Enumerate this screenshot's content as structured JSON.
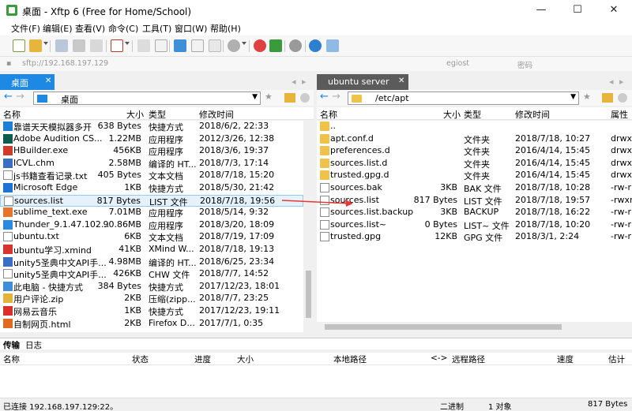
{
  "window": {
    "title": "桌面 - Xftp 6 (Free for Home/School)",
    "minimize": "—",
    "maximize": "☐",
    "close": "✕"
  },
  "menu": [
    "文件(F)",
    "编辑(E)",
    "查看(V)",
    "命令(C)",
    "工具(T)",
    "窗口(W)",
    "帮助(H)"
  ],
  "address": {
    "url": "sftp://192.168.197.129",
    "user_placeholder": "egiost",
    "password_placeholder": "密码"
  },
  "left_pane": {
    "tab": "桌面",
    "path": "桌面",
    "columns": [
      "名称",
      "大小",
      "类型",
      "修改时间"
    ],
    "files": [
      {
        "name": "靠谱天天模拟器多开",
        "size": "638 Bytes",
        "type": "快捷方式",
        "modified": "2018/6/2, 22:33",
        "icon": "#1e7fd6"
      },
      {
        "name": "Adobe Audition CS...",
        "size": "1.22MB",
        "type": "应用程序",
        "modified": "2012/3/26, 12:38",
        "icon": "#0b5e4e"
      },
      {
        "name": "HBuilder.exe",
        "size": "456KB",
        "type": "应用程序",
        "modified": "2018/3/6, 19:37",
        "icon": "#d03a2a"
      },
      {
        "name": "ICVL.chm",
        "size": "2.58MB",
        "type": "编译的 HT...",
        "modified": "2018/7/3, 17:14",
        "icon": "#3b6fc4"
      },
      {
        "name": "js书籍查看记录.txt",
        "size": "405 Bytes",
        "type": "文本文档",
        "modified": "2018/7/18, 15:20",
        "icon": "#ffffff"
      },
      {
        "name": "Microsoft Edge",
        "size": "1KB",
        "type": "快捷方式",
        "modified": "2018/5/30, 21:42",
        "icon": "#1c73d4"
      },
      {
        "name": "sources.list",
        "size": "817 Bytes",
        "type": "LIST 文件",
        "modified": "2018/7/18, 19:56",
        "icon": "#ffffff",
        "selected": true
      },
      {
        "name": "sublime_text.exe",
        "size": "7.01MB",
        "type": "应用程序",
        "modified": "2018/5/14, 9:32",
        "icon": "#e8742b"
      },
      {
        "name": "Thunder_9.1.47.102...",
        "size": "90.86MB",
        "type": "应用程序",
        "modified": "2018/3/20, 18:09",
        "icon": "#2a8be0"
      },
      {
        "name": "ubuntu.txt",
        "size": "6KB",
        "type": "文本文档",
        "modified": "2018/7/19, 17:09",
        "icon": "#ffffff"
      },
      {
        "name": "ubuntu学习.xmind",
        "size": "41KB",
        "type": "XMind W...",
        "modified": "2018/7/18, 19:13",
        "icon": "#d8332c"
      },
      {
        "name": "unity5圣典中文API手...",
        "size": "4.98MB",
        "type": "编译的 HT...",
        "modified": "2018/6/25, 23:34",
        "icon": "#3b6fc4"
      },
      {
        "name": "unity5圣典中文API手...",
        "size": "426KB",
        "type": "CHW 文件",
        "modified": "2018/7/7, 14:52",
        "icon": "#ffffff"
      },
      {
        "name": "此电脑 - 快捷方式",
        "size": "384 Bytes",
        "type": "快捷方式",
        "modified": "2017/12/23, 18:01",
        "icon": "#3f8fd8"
      },
      {
        "name": "用户评论.zip",
        "size": "2KB",
        "type": "压缩(zipp...",
        "modified": "2018/7/7, 23:25",
        "icon": "#e2b53a"
      },
      {
        "name": "网易云音乐",
        "size": "1KB",
        "type": "快捷方式",
        "modified": "2017/12/23, 19:11",
        "icon": "#d8302a"
      },
      {
        "name": "自制网页.html",
        "size": "2KB",
        "type": "Firefox D...",
        "modified": "2017/7/1, 0:35",
        "icon": "#e06a1e"
      }
    ]
  },
  "right_pane": {
    "tab": "ubuntu server",
    "path": "/etc/apt",
    "columns": [
      "名称",
      "大小",
      "类型",
      "修改时间",
      "属性"
    ],
    "files": [
      {
        "name": "..",
        "size": "",
        "type": "",
        "modified": "",
        "attrs": "",
        "folder": true
      },
      {
        "name": "apt.conf.d",
        "size": "",
        "type": "文件夹",
        "modified": "2018/7/18, 10:27",
        "attrs": "drwxr",
        "folder": true
      },
      {
        "name": "preferences.d",
        "size": "",
        "type": "文件夹",
        "modified": "2016/4/14, 15:45",
        "attrs": "drwxr",
        "folder": true
      },
      {
        "name": "sources.list.d",
        "size": "",
        "type": "文件夹",
        "modified": "2016/4/14, 15:45",
        "attrs": "drwxr",
        "folder": true
      },
      {
        "name": "trusted.gpg.d",
        "size": "",
        "type": "文件夹",
        "modified": "2016/4/14, 15:45",
        "attrs": "drwxr",
        "folder": true
      },
      {
        "name": "sources.bak",
        "size": "3KB",
        "type": "BAK 文件",
        "modified": "2018/7/18, 10:28",
        "attrs": "-rw-r",
        "folder": false
      },
      {
        "name": "sources.list",
        "size": "817 Bytes",
        "type": "LIST 文件",
        "modified": "2018/7/18, 19:57",
        "attrs": "-rwxr",
        "folder": false
      },
      {
        "name": "sources.list.backup",
        "size": "3KB",
        "type": "BACKUP",
        "modified": "2018/7/18, 16:22",
        "attrs": "-rw-r",
        "folder": false
      },
      {
        "name": "sources.list~",
        "size": "0 Bytes",
        "type": "LIST~ 文件",
        "modified": "2018/7/18, 10:20",
        "attrs": "-rw-r",
        "folder": false
      },
      {
        "name": "trusted.gpg",
        "size": "12KB",
        "type": "GPG 文件",
        "modified": "2018/3/1, 2:24",
        "attrs": "-rw-r",
        "folder": false
      }
    ]
  },
  "bottom_tabs": [
    "传输",
    "日志"
  ],
  "transfer_columns": [
    "名称",
    "状态",
    "进度",
    "大小",
    "本地路径",
    "<->",
    "远程路径",
    "速度",
    "估计剩"
  ],
  "status": {
    "connection": "已连接 192.168.197.129:22。",
    "mode": "二进制",
    "objects": "1 对象",
    "size": "817 Bytes"
  },
  "colors": {
    "accent_blue": "#1e88e5",
    "tab_dark": "#5b5b5b",
    "selection": "#e5f1fb",
    "arrow_red": "#e53935"
  }
}
